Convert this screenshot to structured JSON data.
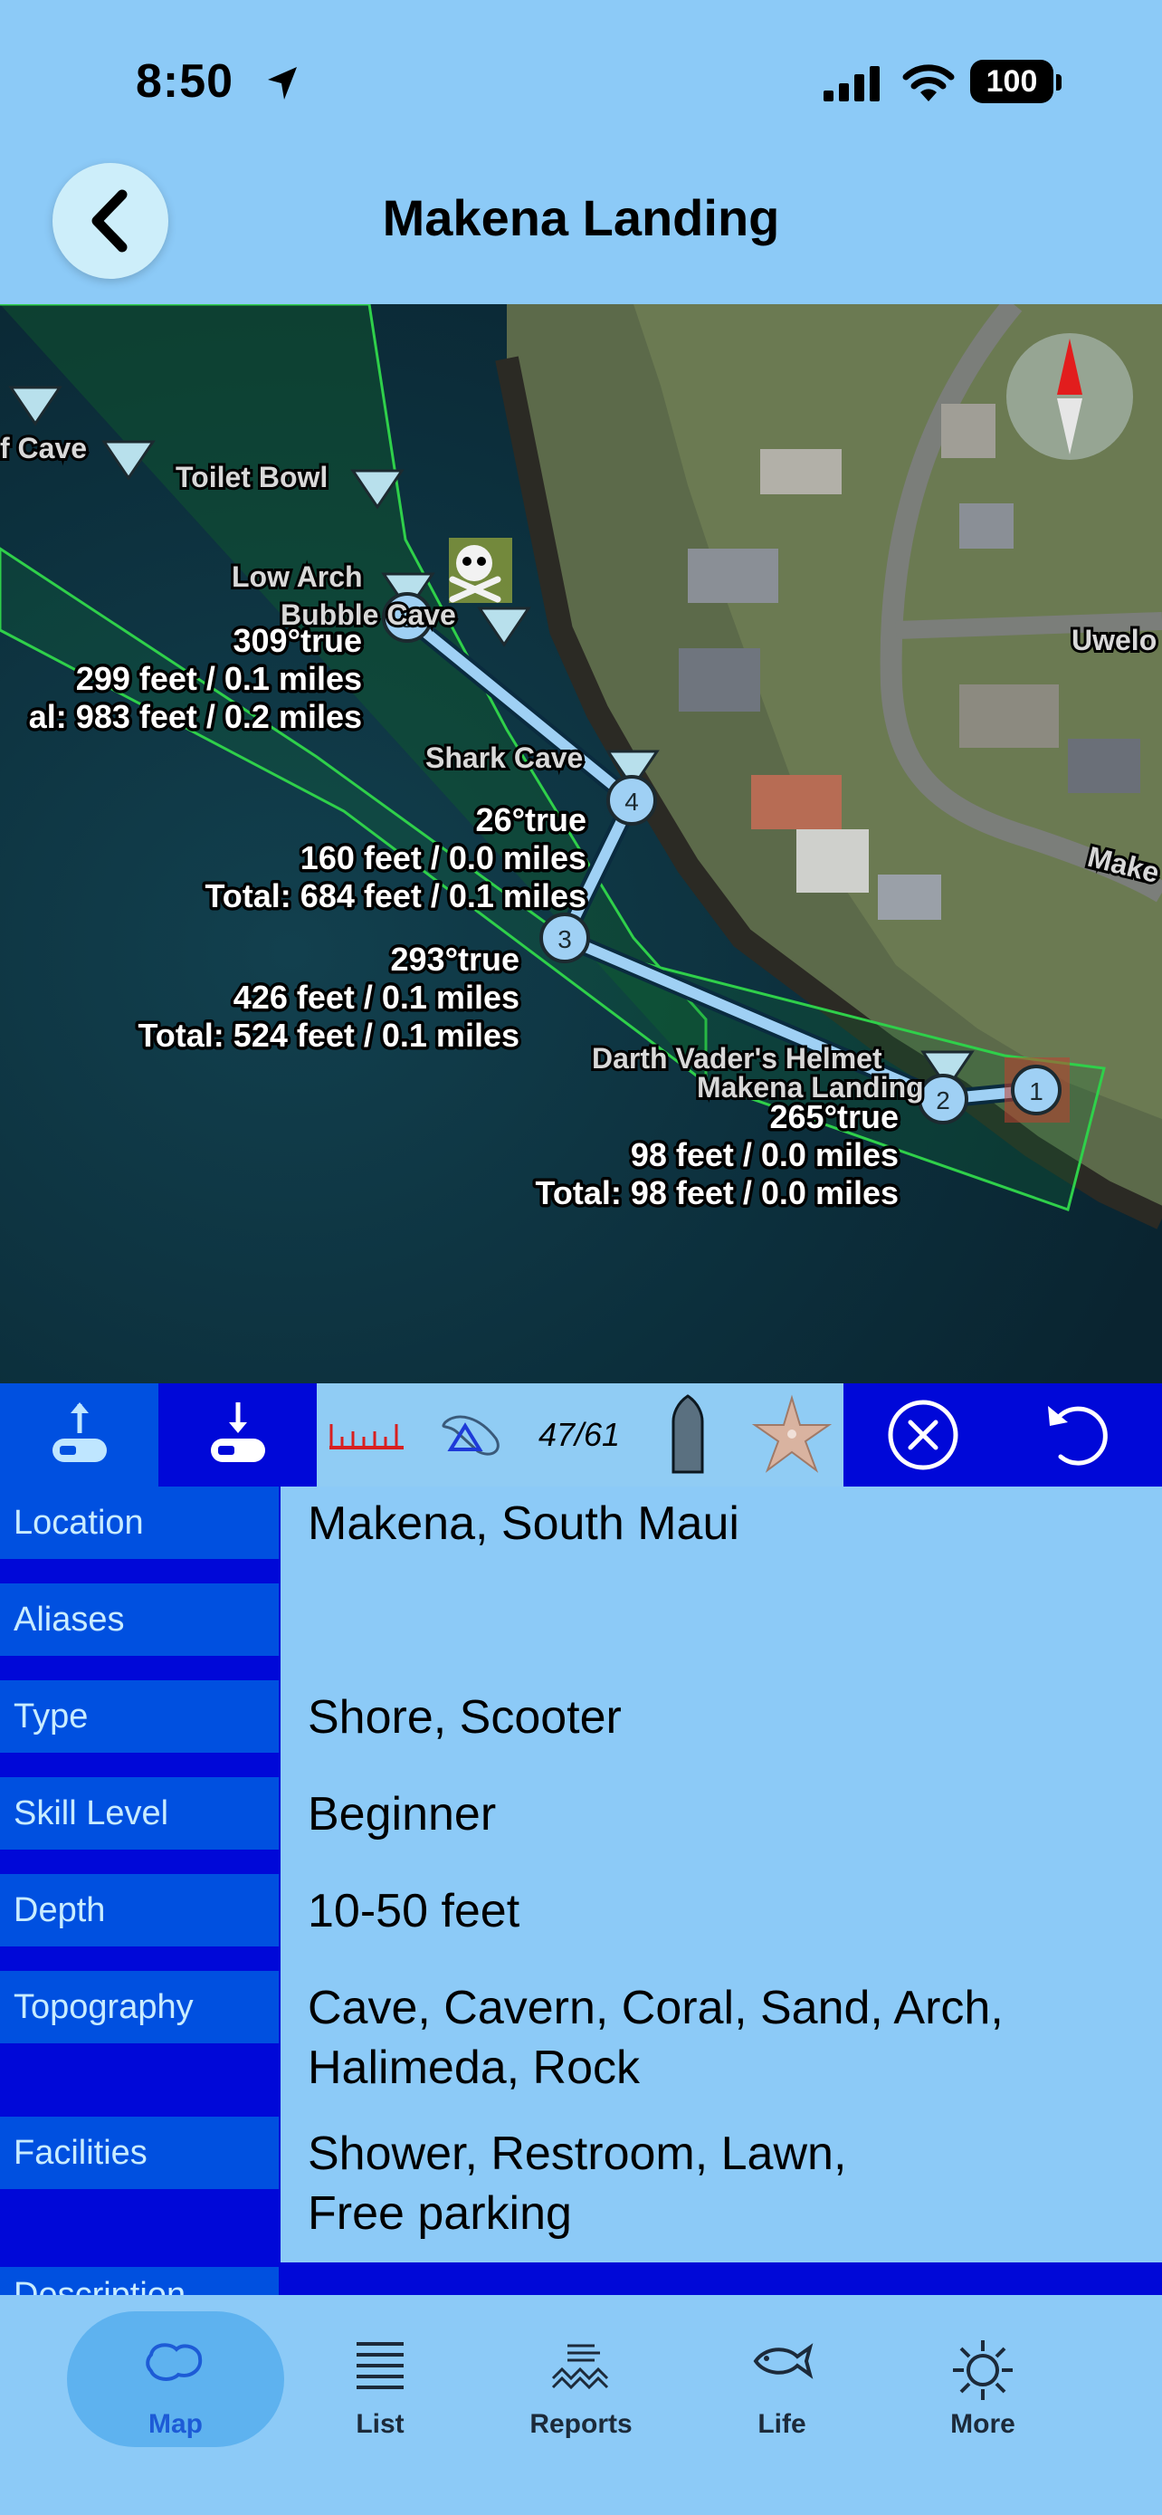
{
  "status": {
    "time": "8:50",
    "battery": "100"
  },
  "header": {
    "title": "Makena Landing"
  },
  "map": {
    "sites": [
      "f Cave",
      "Toilet Bowl",
      "Low Arch",
      "Bubble Cave",
      "Shark Cave",
      "Darth Vader's Helmet",
      "Makena Landing",
      "Uwelo",
      "Make"
    ],
    "route_points": [
      "1",
      "2",
      "3",
      "4",
      "5"
    ],
    "legs": [
      {
        "bearing": "265°true",
        "distance": "98 feet / 0.0 miles",
        "total": "Total: 98 feet / 0.0 miles"
      },
      {
        "bearing": "293°true",
        "distance": "426 feet / 0.1 miles",
        "total": "Total: 524 feet / 0.1 miles"
      },
      {
        "bearing": "26°true",
        "distance": "160 feet / 0.0 miles",
        "total": "Total: 684 feet / 0.1 miles"
      },
      {
        "bearing": "309°true",
        "distance": "299 feet / 0.1 miles",
        "total": "al: 983 feet / 0.2 miles"
      }
    ]
  },
  "toolbar": {
    "count": "47/61"
  },
  "details": {
    "rows": [
      {
        "label": "Location",
        "value": "Makena, South Maui"
      },
      {
        "label": "Aliases",
        "value": ""
      },
      {
        "label": "Type",
        "value": "Shore,  Scooter"
      },
      {
        "label": "Skill Level",
        "value": "Beginner"
      },
      {
        "label": "Depth",
        "value": "10-50 feet"
      },
      {
        "label": "Topography",
        "value": "Cave,  Cavern,  Coral,  Sand,  Arch,",
        "value2": "Halimeda,  Rock"
      },
      {
        "label": "Facilities",
        "value": "Shower,  Restroom,  Lawn,",
        "value2": "Free parking"
      },
      {
        "label": "Description",
        "value": ""
      }
    ]
  },
  "tabs": [
    {
      "label": "Map",
      "icon": "map-icon"
    },
    {
      "label": "List",
      "icon": "list-icon"
    },
    {
      "label": "Reports",
      "icon": "waves-icon"
    },
    {
      "label": "Life",
      "icon": "fish-icon"
    },
    {
      "label": "More",
      "icon": "sun-icon"
    }
  ]
}
